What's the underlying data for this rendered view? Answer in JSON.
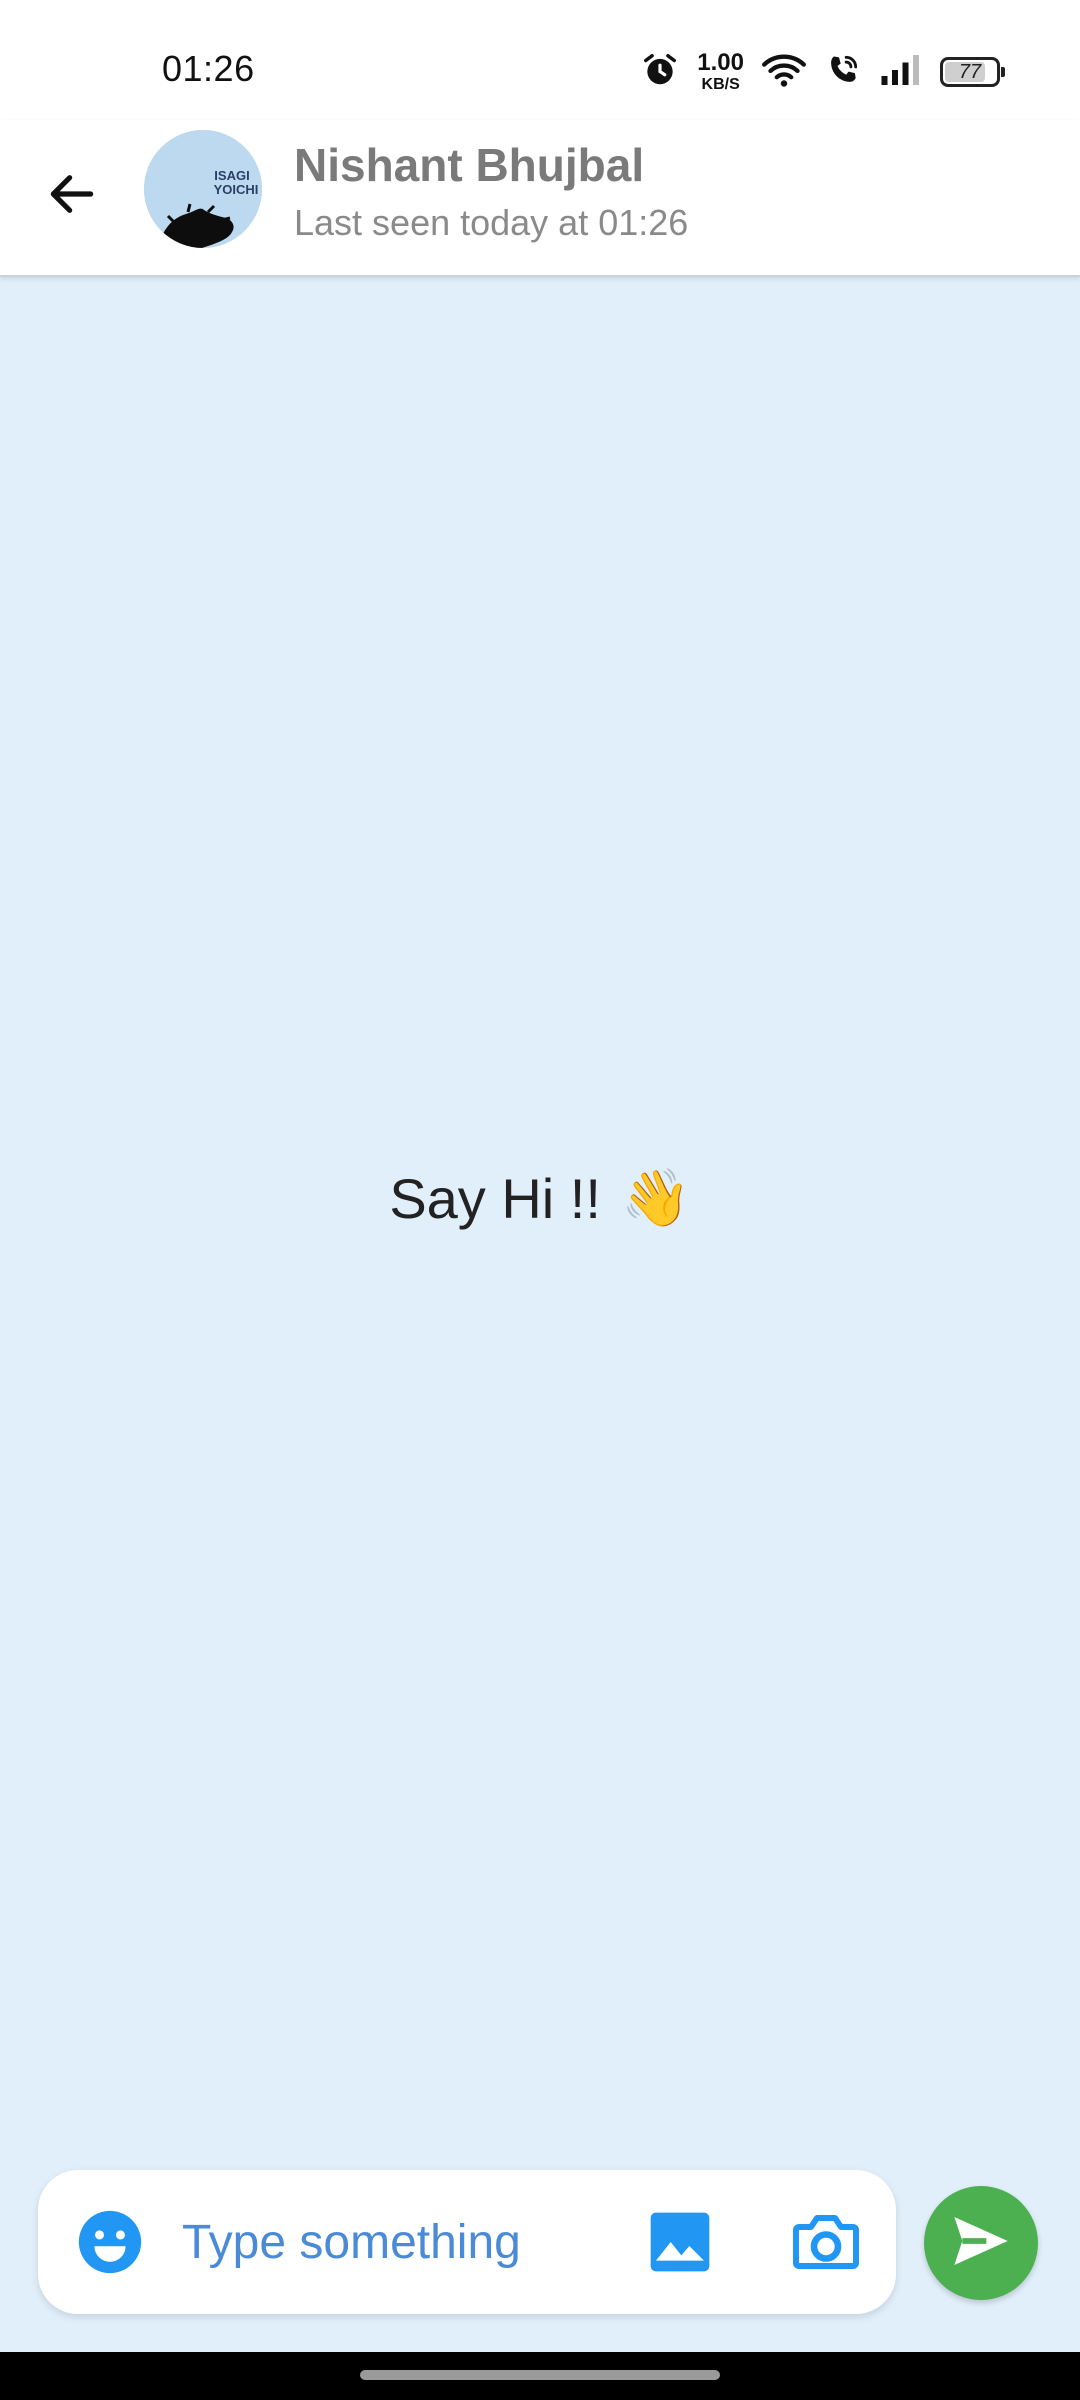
{
  "status_bar": {
    "time": "01:26",
    "net_speed_value": "1.00",
    "net_speed_unit": "KB/S",
    "battery_level": "77",
    "icons": [
      "alarm-icon",
      "wifi-icon",
      "wifi-calling-icon",
      "signal-icon",
      "battery-icon"
    ]
  },
  "header": {
    "back_icon": "arrow-left-icon",
    "avatar_text": [
      "ISAGI",
      "YOICHI"
    ],
    "contact_name": "Nishant Bhujbal",
    "last_seen": "Last seen today at 01:26"
  },
  "chat": {
    "empty_text": "Say Hi !!",
    "empty_emoji": "👋"
  },
  "composer": {
    "placeholder": "Type something",
    "value": "",
    "icons": [
      "emoji-icon",
      "gallery-icon",
      "camera-icon"
    ]
  },
  "send_icon": "send-icon",
  "colors": {
    "chat_background": "#e1effb",
    "accent_blue": "#2196f3",
    "send_green": "#4caf50",
    "name_gray": "#7a7a7a"
  }
}
